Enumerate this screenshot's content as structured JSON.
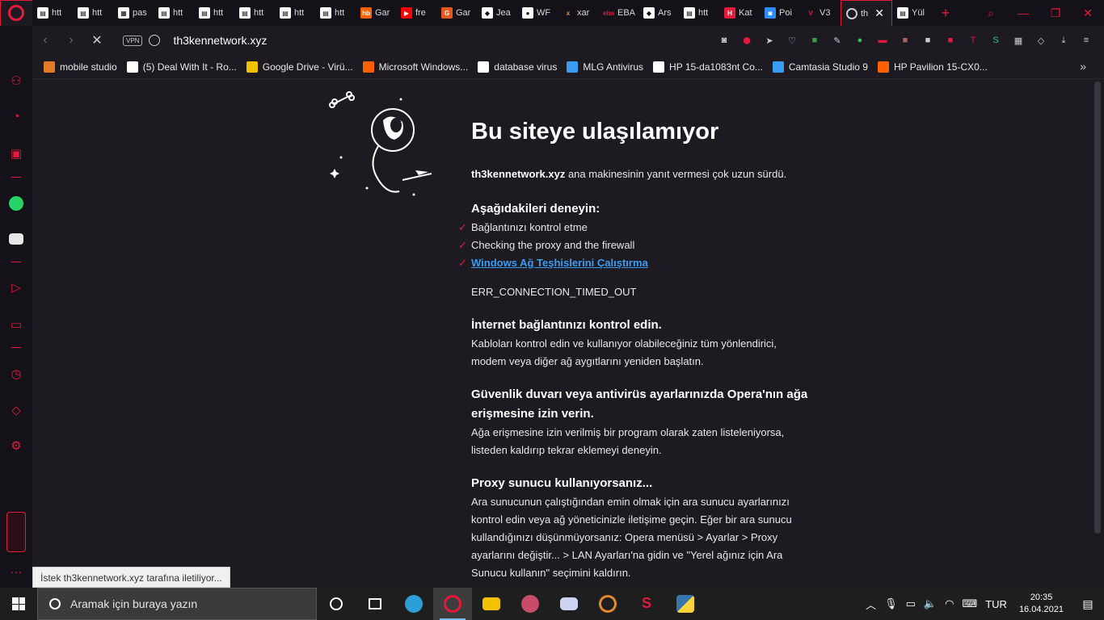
{
  "browser": {
    "tabs": [
      {
        "label": "htt",
        "fav": "doc"
      },
      {
        "label": "htt",
        "fav": "doc"
      },
      {
        "label": "pas",
        "fav": "qr"
      },
      {
        "label": "htt",
        "fav": "doc"
      },
      {
        "label": "htt",
        "fav": "doc"
      },
      {
        "label": "htt",
        "fav": "doc"
      },
      {
        "label": "htt",
        "fav": "doc"
      },
      {
        "label": "htt",
        "fav": "doc"
      },
      {
        "label": "Gar",
        "fav": "hb"
      },
      {
        "label": "fre",
        "fav": "youtube"
      },
      {
        "label": "Gar",
        "fav": "orange"
      },
      {
        "label": "Jea",
        "fav": "roblox"
      },
      {
        "label": "WF",
        "fav": "github"
      },
      {
        "label": "xar",
        "fav": "xar"
      },
      {
        "label": "EBA",
        "fav": "eba"
      },
      {
        "label": "Ars",
        "fav": "roblox"
      },
      {
        "label": "htt",
        "fav": "doc"
      },
      {
        "label": "Kat",
        "fav": "h"
      },
      {
        "label": "Poi",
        "fav": "zoom"
      },
      {
        "label": "V3",
        "fav": "v"
      }
    ],
    "active_tab": {
      "label": "th"
    },
    "after_tabs": [
      {
        "label": "Yül",
        "fav": "doc"
      }
    ],
    "new_tab_label": "+",
    "address": "th3kennetwork.xyz",
    "vpn_label": "VPN",
    "bookmarks": [
      {
        "label": "mobile studio",
        "color": "#e07b28"
      },
      {
        "label": "(5) Deal With It - Ro...",
        "color": "#ffffff"
      },
      {
        "label": "Google Drive - Virü...",
        "color": "#f2c200"
      },
      {
        "label": "Microsoft Windows...",
        "color": "#ff6000"
      },
      {
        "label": "database virus",
        "color": "#ffffff"
      },
      {
        "label": "MLG Antivirus",
        "color": "#3a9cf0"
      },
      {
        "label": "HP 15-da1083nt Co...",
        "color": "#ffffff"
      },
      {
        "label": "Camtasia Studio 9",
        "color": "#3a9cf0"
      },
      {
        "label": "HP Pavilion 15-CX0...",
        "color": "#ff6000"
      }
    ],
    "bookmarks_more": "»",
    "status_tooltip": "İstek th3kennetwork.xyz tarafına iletiliyor..."
  },
  "error_page": {
    "title": "Bu siteye ulaşılamıyor",
    "host": "th3kennetwork.xyz",
    "desc_rest": " ana makinesinin yanıt vermesi çok uzun sürdü.",
    "try_heading": "Aşağıdakileri deneyin:",
    "try_items": [
      "Bağlantınızı kontrol etme",
      "Checking the proxy and the firewall"
    ],
    "try_link": "Windows Ağ Teşhislerini Çalıştırma",
    "check_mark": "✓",
    "error_code": "ERR_CONNECTION_TIMED_OUT",
    "sections": [
      {
        "heading": "İnternet bağlantınızı kontrol edin.",
        "body": "Kabloları kontrol edin ve kullanıyor olabileceğiniz tüm yönlendirici, modem veya diğer ağ aygıtlarını yeniden başlatın."
      },
      {
        "heading": "Güvenlik duvarı veya antivirüs ayarlarınızda Opera'nın ağa erişmesine izin verin.",
        "body": "Ağa erişmesine izin verilmiş bir program olarak zaten listeleniyorsa, listeden kaldırıp tekrar eklemeyi deneyin."
      },
      {
        "heading": "Proxy sunucu kullanıyorsanız...",
        "body": "Ara sunucunun çalıştığından emin olmak için ara sunucu ayarlarınızı kontrol edin veya ağ yöneticinizle iletişime geçin. Eğer bir ara sunucu kullandığınızı düşünmüyorsanız: Opera menüsü > Ayarlar > Proxy ayarlarını değiştir... > LAN Ayarları'na gidin ve \"Yerel ağınız için Ara Sunucu kullanın\" seçimini kaldırın."
      }
    ]
  },
  "taskbar": {
    "search_placeholder": "Aramak için buraya yazın",
    "language": "TUR",
    "time": "20:35",
    "date": "16.04.2021"
  }
}
